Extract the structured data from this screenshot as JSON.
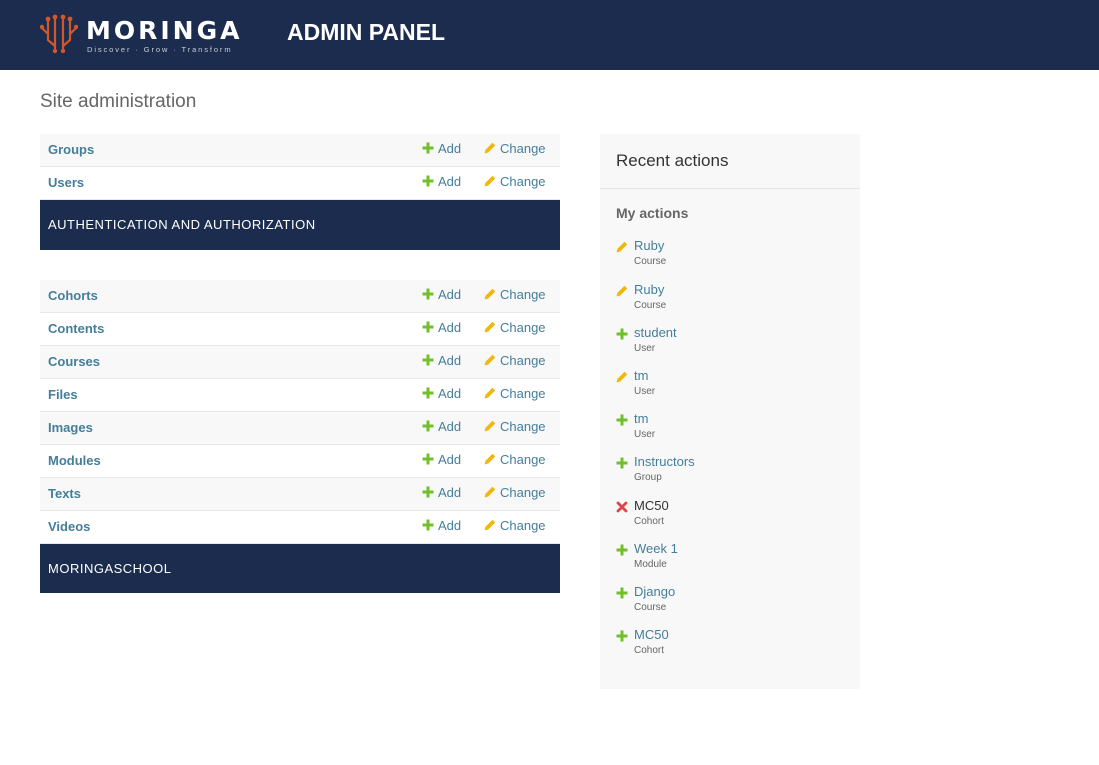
{
  "header": {
    "logo_text": "MORINGA",
    "logo_tagline": "Discover · Grow · Transform",
    "title": "ADMIN PANEL"
  },
  "page_title": "Site administration",
  "modules": [
    {
      "caption": "AUTHENTICATION AND AUTHORIZATION",
      "models": [
        {
          "name": "Groups",
          "add": "Add",
          "change": "Change"
        },
        {
          "name": "Users",
          "add": "Add",
          "change": "Change"
        }
      ]
    },
    {
      "caption": "MORINGASCHOOL",
      "models": [
        {
          "name": "Cohorts",
          "add": "Add",
          "change": "Change"
        },
        {
          "name": "Contents",
          "add": "Add",
          "change": "Change"
        },
        {
          "name": "Courses",
          "add": "Add",
          "change": "Change"
        },
        {
          "name": "Files",
          "add": "Add",
          "change": "Change"
        },
        {
          "name": "Images",
          "add": "Add",
          "change": "Change"
        },
        {
          "name": "Modules",
          "add": "Add",
          "change": "Change"
        },
        {
          "name": "Texts",
          "add": "Add",
          "change": "Change"
        },
        {
          "name": "Videos",
          "add": "Add",
          "change": "Change"
        }
      ]
    }
  ],
  "recent": {
    "title": "Recent actions",
    "subtitle": "My actions",
    "actions": [
      {
        "icon": "pencil-icon",
        "object": "Ruby",
        "type": "Course"
      },
      {
        "icon": "pencil-icon",
        "object": "Ruby",
        "type": "Course"
      },
      {
        "icon": "plus-icon",
        "object": "student",
        "type": "User"
      },
      {
        "icon": "pencil-icon",
        "object": "tm",
        "type": "User"
      },
      {
        "icon": "plus-icon",
        "object": "tm",
        "type": "User"
      },
      {
        "icon": "plus-icon",
        "object": "Instructors",
        "type": "Group"
      },
      {
        "icon": "delete-x-icon",
        "object": "MC50",
        "type": "Cohort"
      },
      {
        "icon": "plus-icon",
        "object": "Week 1",
        "type": "Module"
      },
      {
        "icon": "plus-icon",
        "object": "Django",
        "type": "Course"
      },
      {
        "icon": "plus-icon",
        "object": "MC50",
        "type": "Cohort"
      }
    ]
  },
  "colors": {
    "header_bg": "#1b2c4f",
    "link": "#447e9b",
    "add_green": "#70bf2b",
    "change_yellow": "#efb80b",
    "delete_red": "#dd4646",
    "logo_orange": "#d2572b"
  }
}
